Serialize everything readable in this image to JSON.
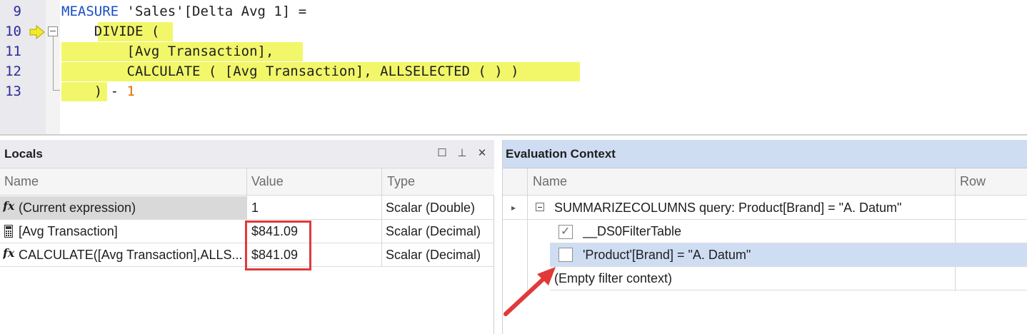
{
  "editor": {
    "line_numbers": [
      "9",
      "10",
      "11",
      "12",
      "13"
    ],
    "lines": [
      {
        "kw": "MEASURE",
        "rest": " 'Sales'[Delta Avg 1] ="
      },
      {
        "indent": "    ",
        "text": "DIVIDE ("
      },
      {
        "indent": "        ",
        "text": "[Avg Transaction],"
      },
      {
        "indent": "        ",
        "text": "CALCULATE ( [Avg Transaction], ALLSELECTED ( ) )"
      },
      {
        "indent": "    ",
        "text": ") - ",
        "num": "1"
      }
    ]
  },
  "locals": {
    "title": "Locals",
    "buttons": {
      "maximize": "☐",
      "pin": "⊥",
      "close": "✕"
    },
    "columns": {
      "name": "Name",
      "value": "Value",
      "type": "Type"
    },
    "rows": [
      {
        "icon": "fx",
        "name": "(Current expression)",
        "value": "1",
        "type": "Scalar (Double)"
      },
      {
        "icon": "calculator",
        "name": "[Avg Transaction]",
        "value": "$841.09",
        "type": "Scalar (Decimal)"
      },
      {
        "icon": "fx",
        "name": "CALCULATE([Avg Transaction],ALLS...",
        "value": "$841.09",
        "type": "Scalar (Decimal)"
      }
    ],
    "fx_symbol": "fx"
  },
  "eval": {
    "title": "Evaluation Context",
    "columns": {
      "name": "Name",
      "row": "Row"
    },
    "group": "SUMMARIZECOLUMNS query: Product[Brand] = \"A. Datum\"",
    "items": [
      {
        "label": "__DS0FilterTable",
        "checked": true
      },
      {
        "label": "'Product'[Brand] = \"A. Datum\"",
        "checked": false
      }
    ],
    "empty": "(Empty filter context)"
  },
  "colors": {
    "highlight": "#f2f76a",
    "keyword": "#1a4fc4",
    "annotation": "#e03a3a",
    "selection": "#cfddf3"
  }
}
